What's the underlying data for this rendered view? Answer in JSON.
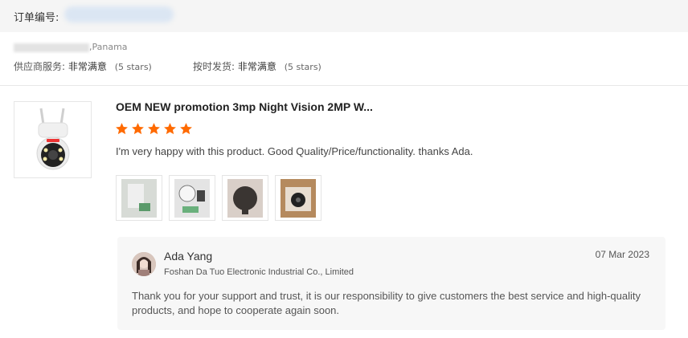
{
  "order": {
    "label": "订单编号:"
  },
  "buyer": {
    "location": ",Panama"
  },
  "ratings": [
    {
      "label": "供应商服务:",
      "value": "非常满意",
      "stars": "(5 stars)"
    },
    {
      "label": "按时发货:",
      "value": "非常满意",
      "stars": "(5 stars)"
    }
  ],
  "product": {
    "title": "OEM NEW promotion 3mp Night Vision 2MP W...",
    "rating": 5,
    "review": "I'm very happy with this product. Good Quality/Price/functionality. thanks Ada.",
    "star_color": "#ff6a00"
  },
  "reply": {
    "name": "Ada Yang",
    "company": "Foshan Da Tuo Electronic Industrial Co., Limited",
    "date": "07 Mar 2023",
    "text": "Thank you for your support and trust, it is our responsibility to give customers the best service and high-quality products, and hope to cooperate again soon."
  }
}
